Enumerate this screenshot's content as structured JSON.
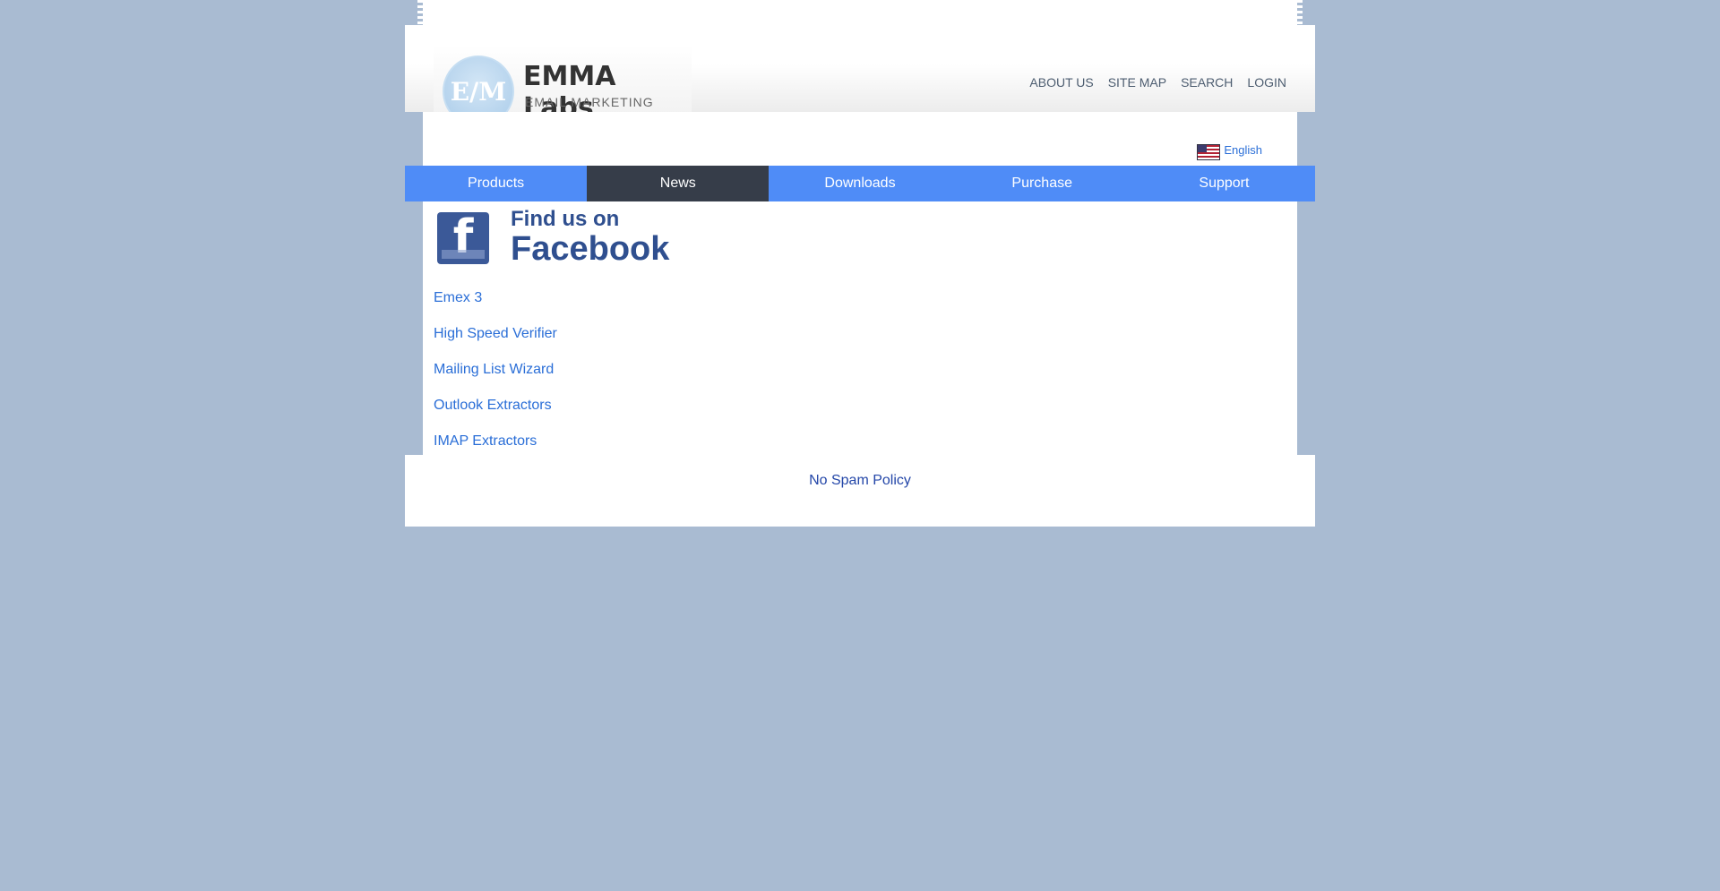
{
  "brand": {
    "logo_mark": "E/M",
    "name": "EMMA Labs",
    "tagline": "EMAIL MARKETING"
  },
  "topnav": [
    "ABOUT US",
    "SITE MAP",
    "SEARCH",
    "LOGIN"
  ],
  "language": {
    "label": "English",
    "flag": "us-flag-icon"
  },
  "menu": {
    "items": [
      "Products",
      "News",
      "Downloads",
      "Purchase",
      "Support"
    ],
    "active_index": 1,
    "colors": {
      "bar": "#4f8cf7",
      "active": "#363d49"
    }
  },
  "facebook": {
    "line1": "Find us on",
    "line2": "Facebook",
    "icon": "facebook-icon"
  },
  "links": [
    "Emex 3",
    "High Speed Verifier",
    "Mailing List Wizard",
    "Outlook Extractors",
    "IMAP Extractors"
  ],
  "footer": {
    "policy": "No Spam Policy"
  },
  "colors": {
    "background": "#a9bbd2",
    "link": "#2a6ed7"
  }
}
